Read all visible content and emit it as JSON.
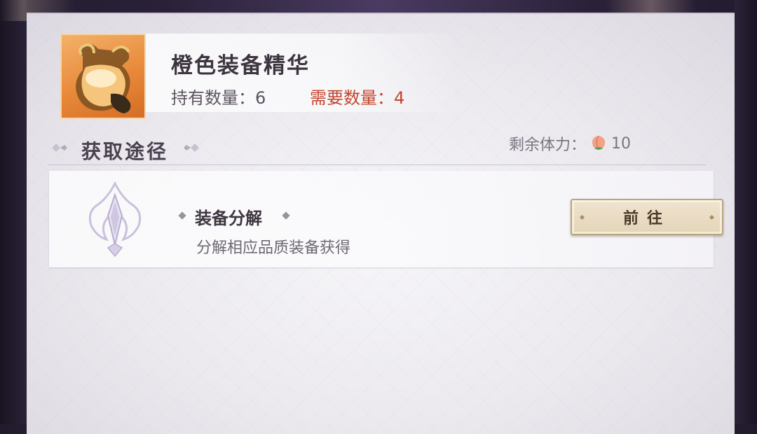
{
  "item": {
    "name": "橙色装备精华",
    "own_label": "持有数量：6",
    "need_label": "需要数量：4",
    "icon": "orange-essence-vase-icon"
  },
  "section": {
    "title": "获取途径"
  },
  "stamina": {
    "label": "剩余体力：",
    "value": "10",
    "icon": "peach-icon"
  },
  "sources": [
    {
      "title": "装备分解",
      "description": "分解相应品质装备获得",
      "button_label": "前往",
      "icon": "decompose-crystal-icon"
    }
  ],
  "colors": {
    "need_red": "#c2452e",
    "icon_orange": "#e8893a",
    "button_beige": "#e4d5b8"
  }
}
